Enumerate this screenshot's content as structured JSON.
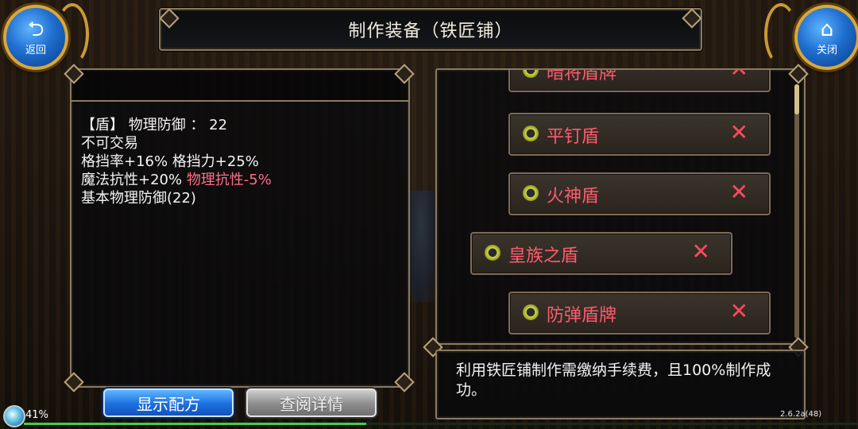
{
  "window": {
    "title": "制作装备（铁匠铺）"
  },
  "nav": {
    "back_label": "返回",
    "back_icon": "back-arrow-icon",
    "close_label": "关闭",
    "close_icon": "home-icon"
  },
  "item_detail": {
    "lines": [
      {
        "text": "【盾】 物理防御 ：  22"
      },
      {
        "text": "不可交易"
      },
      {
        "text": "格挡率+16% 格挡力+25%"
      },
      {
        "text_main": "魔法抗性+20% ",
        "text_negative": "物理抗性-5%"
      },
      {
        "text": "基本物理防御(22)"
      }
    ]
  },
  "buttons": {
    "show_recipe": "显示配方",
    "view_details": "查阅详情"
  },
  "recipes": [
    {
      "name": "暗将盾牌",
      "status": "unavailable",
      "selected": false
    },
    {
      "name": "平钉盾",
      "status": "unavailable",
      "selected": false
    },
    {
      "name": "火神盾",
      "status": "unavailable",
      "selected": false
    },
    {
      "name": "皇族之盾",
      "status": "unavailable",
      "selected": true
    },
    {
      "name": "防弹盾牌",
      "status": "unavailable",
      "selected": false
    }
  ],
  "info": {
    "text": "利用铁匠铺制作需缴纳手续费，且100%制作成功。"
  },
  "status": {
    "percent": "41%",
    "version": "2.6.2a(48)",
    "progress_fraction": 0.41
  },
  "colors": {
    "recipe_text": "#ff5b6e",
    "negative_stat": "#ff6f8a",
    "accent_blue": "#1b6fe0",
    "frame_gold": "#d9a83a"
  }
}
